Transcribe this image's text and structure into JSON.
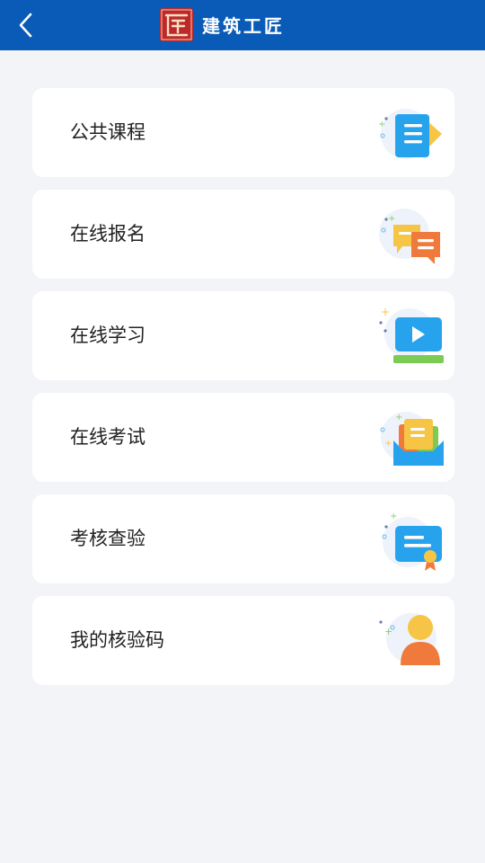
{
  "header": {
    "title": "建筑工匠",
    "logo_char": "匠",
    "back_icon": "chevron-left-icon",
    "bar_color": "#0a5ab7"
  },
  "menu": {
    "items": [
      {
        "label": "公共课程",
        "icon": "course-document-icon"
      },
      {
        "label": "在线报名",
        "icon": "registration-chat-icon"
      },
      {
        "label": "在线学习",
        "icon": "video-play-icon"
      },
      {
        "label": "在线考试",
        "icon": "exam-tray-icon"
      },
      {
        "label": "考核查验",
        "icon": "certificate-check-icon"
      },
      {
        "label": "我的核验码",
        "icon": "user-avatar-icon"
      }
    ]
  }
}
